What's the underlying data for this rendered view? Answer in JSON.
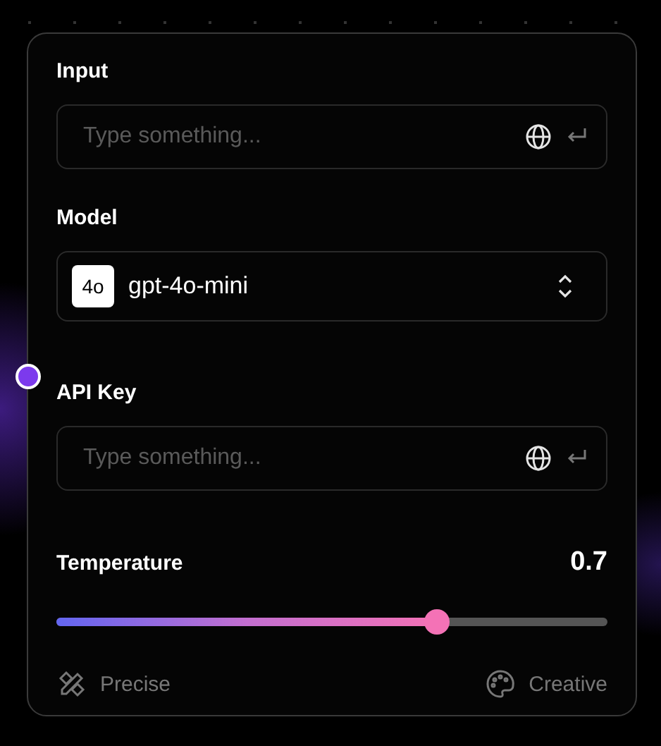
{
  "fields": [
    {
      "kind": "text",
      "label": "Input",
      "placeholder": "Type something..."
    },
    {
      "kind": "select",
      "label": "Model",
      "badge": "4o",
      "value": "gpt-4o-mini"
    },
    {
      "kind": "text",
      "label": "API Key",
      "placeholder": "Type something..."
    }
  ],
  "temperature": {
    "label": "Temperature",
    "reading": "0.7",
    "level": 0.69,
    "min_label": "Precise",
    "max_label": "Creative"
  }
}
